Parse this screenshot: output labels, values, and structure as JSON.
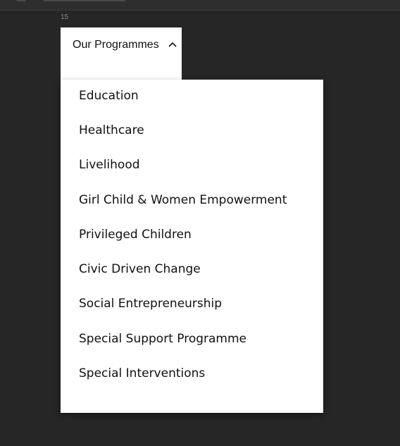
{
  "editor": {
    "line_number": "15"
  },
  "menu": {
    "trigger_label": "Our Programmes",
    "trigger_icon": "chevron-up-icon",
    "items": [
      {
        "label": "Education"
      },
      {
        "label": "Healthcare"
      },
      {
        "label": "Livelihood"
      },
      {
        "label": "Girl Child & Women Empowerment"
      },
      {
        "label": "Privileged Children"
      },
      {
        "label": "Civic Driven Change"
      },
      {
        "label": "Social Entrepreneurship"
      },
      {
        "label": "Special Support Programme"
      },
      {
        "label": "Special Interventions"
      }
    ]
  },
  "colors": {
    "background": "#262626",
    "panel": "#ffffff",
    "text": "#111111",
    "line_number": "#8a8a8a"
  }
}
